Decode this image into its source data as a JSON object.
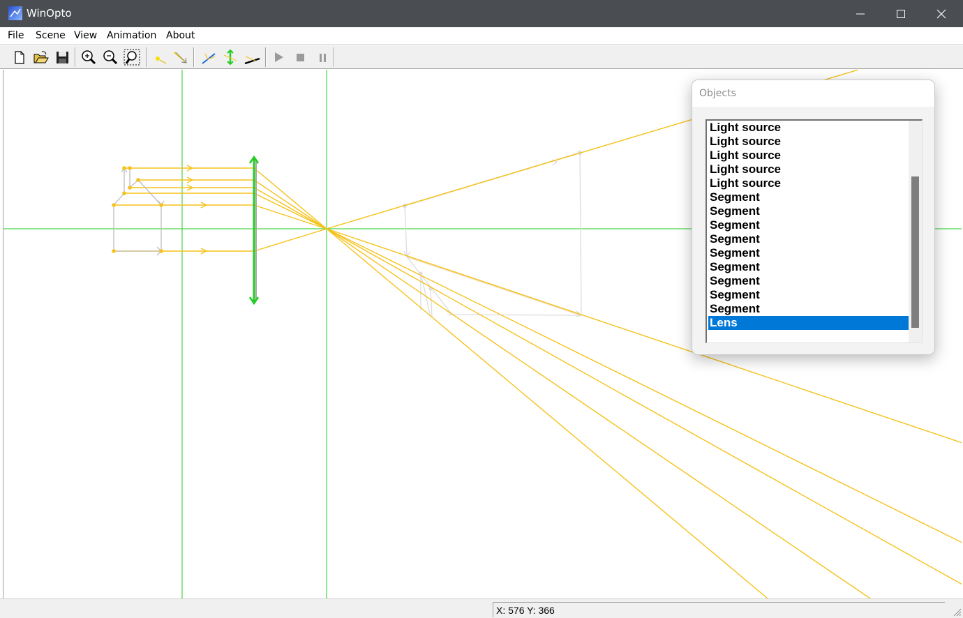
{
  "app": {
    "title": "WinOpto"
  },
  "menu": [
    "File",
    "Scene",
    "View",
    "Animation",
    "About"
  ],
  "toolbar": {
    "buttons": [
      "new-icon",
      "open-icon",
      "save-icon",
      "zoom-in-icon",
      "zoom-out-icon",
      "zoom-fit-icon",
      "light-source-icon",
      "ray-icon",
      "mirror-icon",
      "lens-icon",
      "segment-icon",
      "play-icon",
      "stop-icon",
      "pause-icon"
    ]
  },
  "objects_panel": {
    "title": "Objects",
    "items": [
      "Light source",
      "Light source",
      "Light source",
      "Light source",
      "Light source",
      "Segment",
      "Segment",
      "Segment",
      "Segment",
      "Segment",
      "Segment",
      "Segment",
      "Segment",
      "Segment",
      "Lens"
    ],
    "selected_index": 14
  },
  "status": {
    "coords": "X: 576  Y: 366"
  },
  "colors": {
    "ray": "#f5c21b",
    "axis": "#22cc22",
    "lens": "#22cc22",
    "object": "#bdbdbd",
    "selection": "#0078d7",
    "titlebar": "#4a4d51"
  }
}
